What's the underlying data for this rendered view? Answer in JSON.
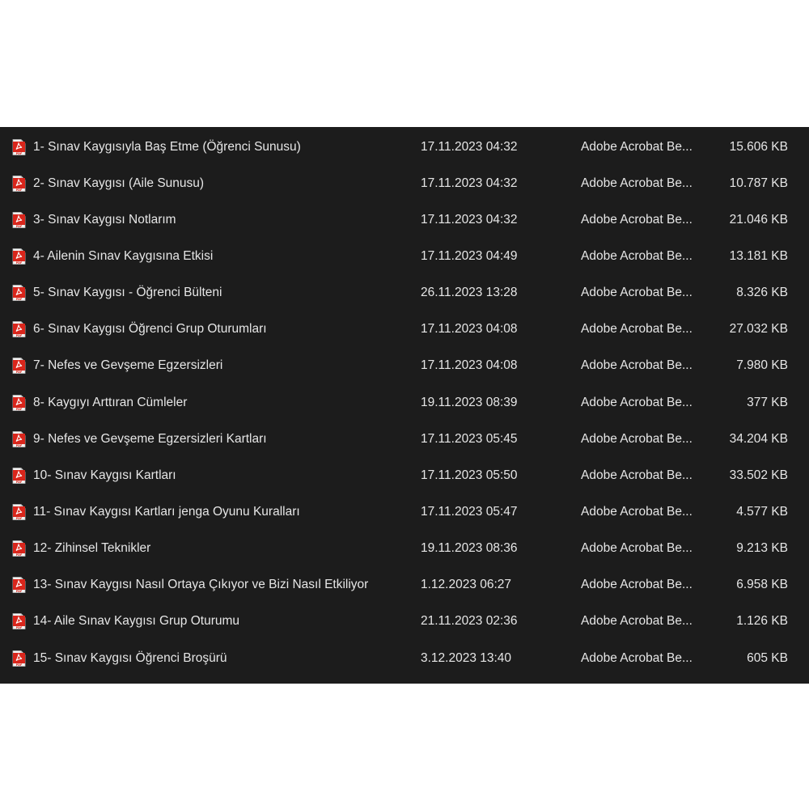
{
  "file_list": {
    "files": [
      {
        "name": "1- Sınav Kaygısıyla Baş Etme (Öğrenci Sunusu)",
        "date_modified": "17.11.2023 04:32",
        "type": "Adobe Acrobat Be...",
        "size": "15.606 KB",
        "icon": "pdf-file-icon"
      },
      {
        "name": "2- Sınav Kaygısı (Aile Sunusu)",
        "date_modified": "17.11.2023 04:32",
        "type": "Adobe Acrobat Be...",
        "size": "10.787 KB",
        "icon": "pdf-file-icon"
      },
      {
        "name": "3- Sınav Kaygısı Notlarım",
        "date_modified": "17.11.2023 04:32",
        "type": "Adobe Acrobat Be...",
        "size": "21.046 KB",
        "icon": "pdf-file-icon"
      },
      {
        "name": "4- Ailenin Sınav Kaygısına Etkisi",
        "date_modified": "17.11.2023 04:49",
        "type": "Adobe Acrobat Be...",
        "size": "13.181 KB",
        "icon": "pdf-file-icon"
      },
      {
        "name": "5- Sınav Kaygısı - Öğrenci Bülteni",
        "date_modified": "26.11.2023 13:28",
        "type": "Adobe Acrobat Be...",
        "size": "8.326 KB",
        "icon": "pdf-file-icon"
      },
      {
        "name": "6- Sınav Kaygısı Öğrenci Grup Oturumları",
        "date_modified": "17.11.2023 04:08",
        "type": "Adobe Acrobat Be...",
        "size": "27.032 KB",
        "icon": "pdf-file-icon"
      },
      {
        "name": "7- Nefes ve Gevşeme Egzersizleri",
        "date_modified": "17.11.2023 04:08",
        "type": "Adobe Acrobat Be...",
        "size": "7.980 KB",
        "icon": "pdf-file-icon"
      },
      {
        "name": "8- Kaygıyı Arttıran Cümleler",
        "date_modified": "19.11.2023 08:39",
        "type": "Adobe Acrobat Be...",
        "size": "377 KB",
        "icon": "pdf-file-icon"
      },
      {
        "name": "9- Nefes ve Gevşeme Egzersizleri Kartları",
        "date_modified": "17.11.2023 05:45",
        "type": "Adobe Acrobat Be...",
        "size": "34.204 KB",
        "icon": "pdf-file-icon"
      },
      {
        "name": "10- Sınav Kaygısı Kartları",
        "date_modified": "17.11.2023 05:50",
        "type": "Adobe Acrobat Be...",
        "size": "33.502 KB",
        "icon": "pdf-file-icon"
      },
      {
        "name": "11- Sınav Kaygısı Kartları jenga Oyunu Kuralları",
        "date_modified": "17.11.2023 05:47",
        "type": "Adobe Acrobat Be...",
        "size": "4.577 KB",
        "icon": "pdf-file-icon"
      },
      {
        "name": "12- Zihinsel Teknikler",
        "date_modified": "19.11.2023 08:36",
        "type": "Adobe Acrobat Be...",
        "size": "9.213 KB",
        "icon": "pdf-file-icon"
      },
      {
        "name": "13- Sınav Kaygısı Nasıl Ortaya Çıkıyor ve Bizi Nasıl Etkiliyor",
        "date_modified": "1.12.2023 06:27",
        "type": "Adobe Acrobat Be...",
        "size": "6.958 KB",
        "icon": "pdf-file-icon"
      },
      {
        "name": "14- Aile Sınav Kaygısı Grup Oturumu",
        "date_modified": "21.11.2023 02:36",
        "type": "Adobe Acrobat Be...",
        "size": "1.126 KB",
        "icon": "pdf-file-icon"
      },
      {
        "name": "15- Sınav Kaygısı Öğrenci Broşürü",
        "date_modified": "3.12.2023 13:40",
        "type": "Adobe Acrobat Be...",
        "size": "605 KB",
        "icon": "pdf-file-icon"
      }
    ]
  },
  "colors": {
    "panel_background": "#1c1c1c",
    "text": "#e6e6e6",
    "pdf_icon_red": "#d9261c",
    "page_background": "#ffffff"
  }
}
